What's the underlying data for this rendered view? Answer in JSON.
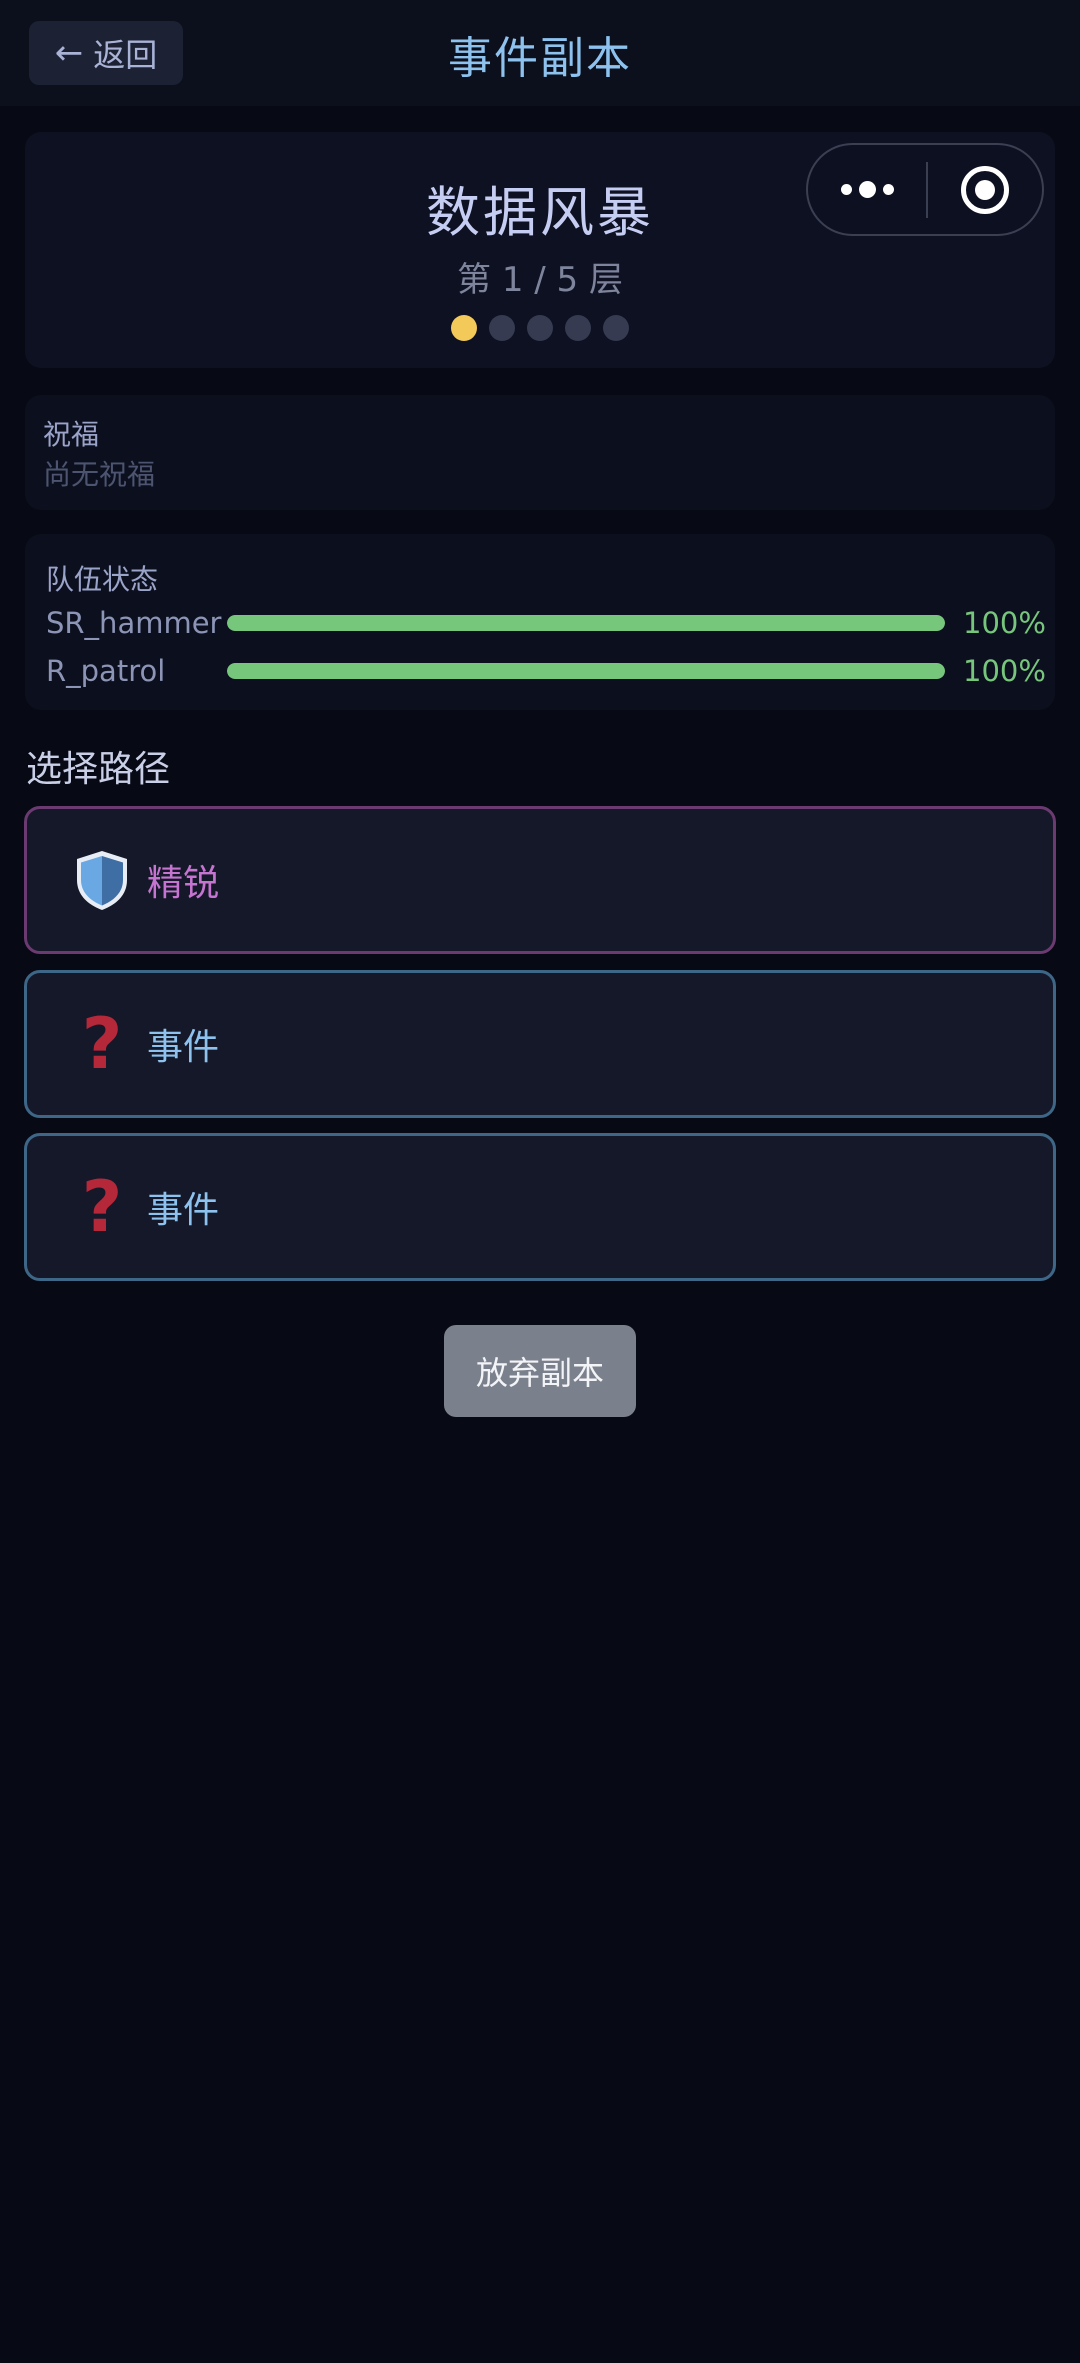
{
  "header": {
    "back_label": "返回",
    "title": "事件副本"
  },
  "dungeon": {
    "name": "数据风暴",
    "floor_text": "第 1 / 5 层",
    "current_floor": 1,
    "total_floors": 5
  },
  "blessing": {
    "title": "祝福",
    "empty_text": "尚无祝福"
  },
  "team": {
    "title": "队伍状态",
    "members": [
      {
        "name": "SR_hammer",
        "hp_percent": 100,
        "hp_text": "100%"
      },
      {
        "name": "R_patrol",
        "hp_percent": 100,
        "hp_text": "100%"
      }
    ]
  },
  "paths": {
    "title": "选择路径",
    "options": [
      {
        "label": "精锐",
        "icon": "shield-icon"
      },
      {
        "label": "事件",
        "icon": "question-mark-icon"
      },
      {
        "label": "事件",
        "icon": "question-mark-icon"
      }
    ]
  },
  "abandon_label": "放弃副本",
  "colors": {
    "accent": "#8ec2ee",
    "elite": "#c574cf",
    "hp": "#76c67c",
    "active_dot": "#f3c95a",
    "event_icon": "#b4283a"
  }
}
